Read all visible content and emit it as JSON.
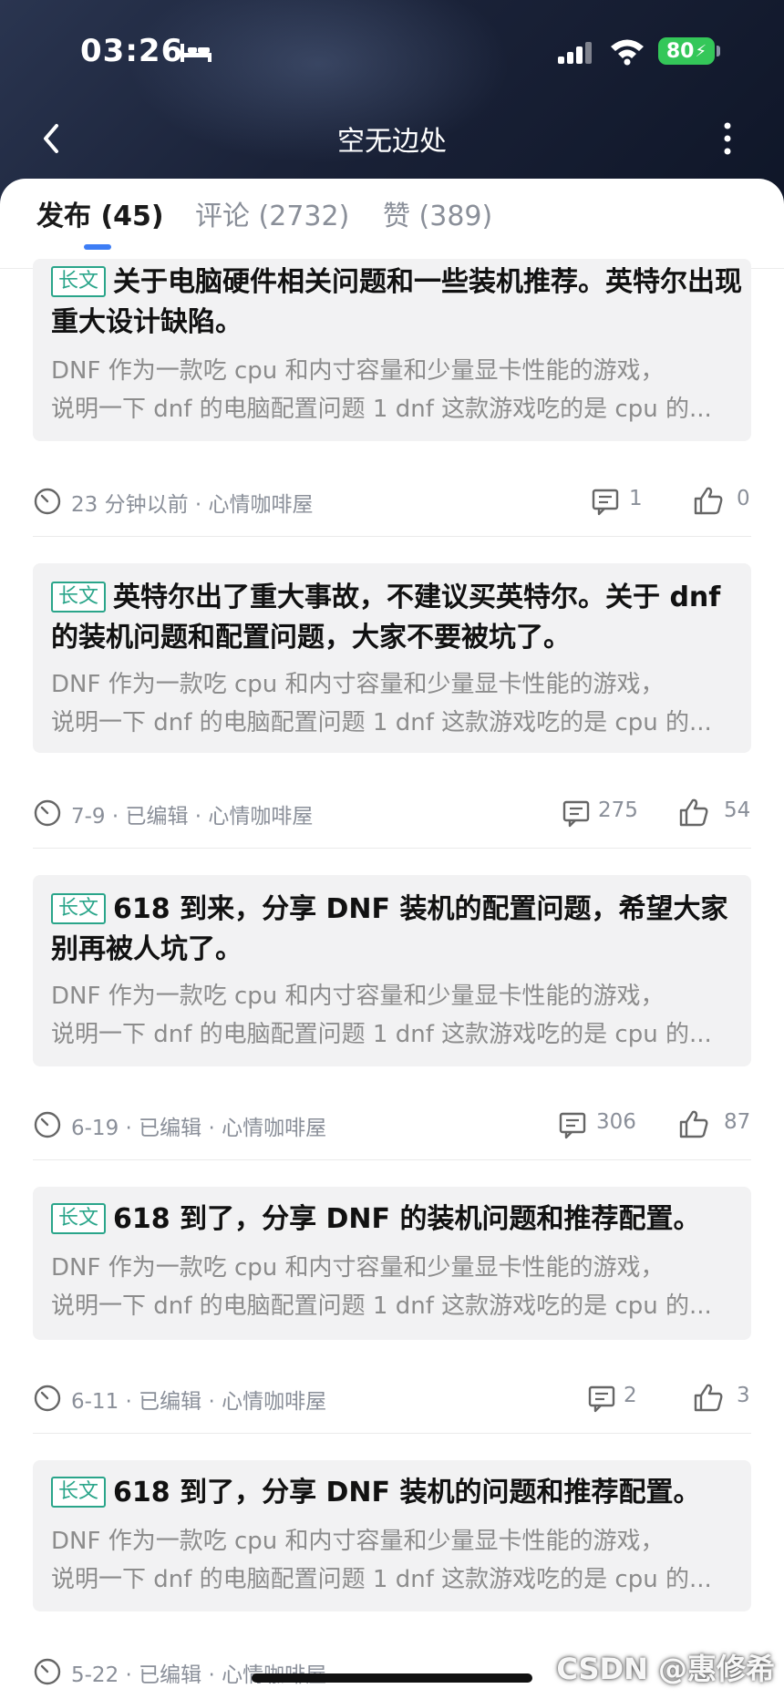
{
  "status_bar": {
    "time": "03:26",
    "battery": "80"
  },
  "nav": {
    "title": "空无边处"
  },
  "tabs": [
    {
      "label": "发布 (45)"
    },
    {
      "label": "评论 (2732)"
    },
    {
      "label": "赞 (389)"
    }
  ],
  "tag_label": "长文",
  "posts": [
    {
      "title": "关于电脑硬件相关问题和一些装机推荐。英特尔出现重大设计缺陷。",
      "excerpt_1": "DNF 作为一款吃 cpu 和内寸容量和少量显卡性能的游戏，",
      "excerpt_2": "说明一下 dnf 的电脑配置问题 1 dnf 这款游戏吃的是 cpu 的...",
      "meta": "23 分钟以前 · 心情咖啡屋",
      "comments": "1",
      "likes": "0"
    },
    {
      "title": "英特尔出了重大事故，不建议买英特尔。关于 dnf 的装机问题和配置问题，大家不要被坑了。",
      "excerpt_1": "  DNF 作为一款吃 cpu 和内寸容量和少量显卡性能的游戏，",
      "excerpt_2": "说明一下 dnf 的电脑配置问题 1 dnf 这款游戏吃的是 cpu 的...",
      "meta": "7-9 · 已编辑 · 心情咖啡屋",
      "comments": "275",
      "likes": "54"
    },
    {
      "title": "618 到来，分享 DNF 装机的配置问题，希望大家别再被人坑了。",
      "excerpt_1": "  DNF 作为一款吃 cpu 和内寸容量和少量显卡性能的游戏，",
      "excerpt_2": "说明一下 dnf 的电脑配置问题 1 dnf 这款游戏吃的是 cpu 的...",
      "meta": "6-19 · 已编辑 · 心情咖啡屋",
      "comments": "306",
      "likes": "87"
    },
    {
      "title": "618 到了，分享 DNF 的装机问题和推荐配置。",
      "excerpt_1": "  DNF 作为一款吃 cpu 和内寸容量和少量显卡性能的游戏，",
      "excerpt_2": "说明一下 dnf 的电脑配置问题 1 dnf 这款游戏吃的是 cpu 的...",
      "meta": "6-11 · 已编辑 · 心情咖啡屋",
      "comments": "2",
      "likes": "3"
    },
    {
      "title": "618 到了，分享 DNF 装机的问题和推荐配置。",
      "excerpt_1": "  DNF 作为一款吃 cpu 和内寸容量和少量显卡性能的游戏，",
      "excerpt_2": "说明一下 dnf 的电脑配置问题 1 dnf 这款游戏吃的是 cpu 的...",
      "meta": "5-22 · 已编辑 · 心情咖啡屋",
      "comments": "",
      "likes": ""
    }
  ],
  "watermark": "CSDN @惠修希"
}
